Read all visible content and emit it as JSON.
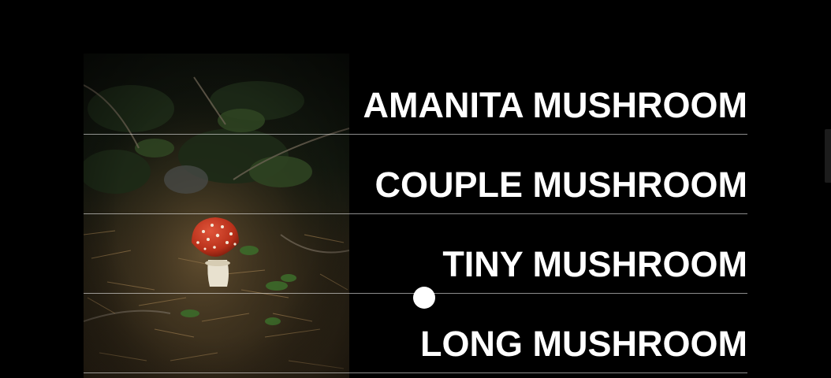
{
  "menu": {
    "items": [
      {
        "label": "AMANITA MUSHROOM"
      },
      {
        "label": "COUPLE MUSHROOM"
      },
      {
        "label": "TINY MUSHROOM"
      },
      {
        "label": "LONG MUSHROOM"
      }
    ]
  },
  "colors": {
    "background": "#000000",
    "text": "#ffffff",
    "divider": "rgba(255,255,255,0.55)",
    "cap": "#c6361f"
  }
}
